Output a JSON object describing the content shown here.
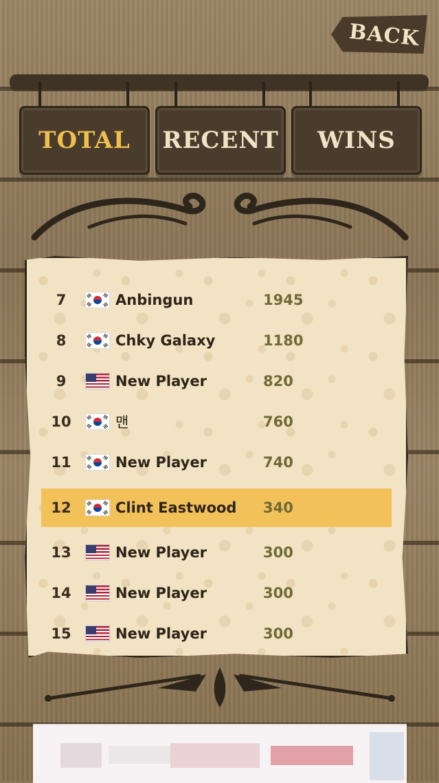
{
  "header": {
    "back_label": "BACK"
  },
  "tabs": [
    {
      "label": "TOTAL",
      "active": true
    },
    {
      "label": "RECENT",
      "active": false
    },
    {
      "label": "WINS",
      "active": false
    }
  ],
  "leaderboard": [
    {
      "rank": "7",
      "flag": "kr",
      "name": "Anbingun",
      "score": "1945"
    },
    {
      "rank": "8",
      "flag": "kr",
      "name": "Chky Galaxy",
      "score": "1180"
    },
    {
      "rank": "9",
      "flag": "us",
      "name": "New Player",
      "score": "820"
    },
    {
      "rank": "10",
      "flag": "kr",
      "name": "맨",
      "score": "760"
    },
    {
      "rank": "11",
      "flag": "kr",
      "name": "New Player",
      "score": "740"
    },
    {
      "rank": "12",
      "flag": "kr",
      "name": "Clint Eastwood",
      "score": "340",
      "highlight": true
    },
    {
      "rank": "13",
      "flag": "us",
      "name": "New Player",
      "score": "300"
    },
    {
      "rank": "14",
      "flag": "us",
      "name": "New Player",
      "score": "300"
    },
    {
      "rank": "15",
      "flag": "us",
      "name": "New Player",
      "score": "300"
    }
  ],
  "colors": {
    "active_tab_text": "#efbf4d",
    "highlight_row": "#f3c15a",
    "score_text": "#6f6a35"
  }
}
